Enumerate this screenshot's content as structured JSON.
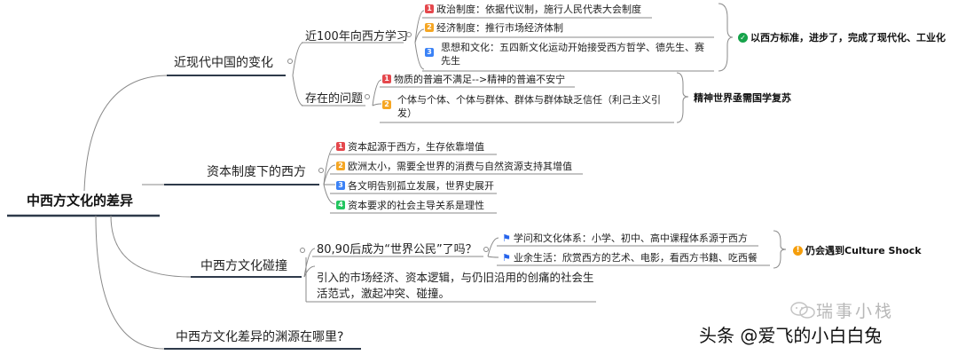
{
  "root": "中西方文化的差异",
  "branches": [
    {
      "label": "近现代中国的变化",
      "subs": [
        {
          "label": "近100年向西方学习",
          "leaves": [
            {
              "badge": "1",
              "text": "政治制度：依据代议制，施行人民代表大会制度"
            },
            {
              "badge": "2",
              "text": "经济制度：推行市场经济体制"
            },
            {
              "badge": "3",
              "text": "思想和文化：五四新文化运动开始接受西方哲学、德先生、赛先生"
            }
          ],
          "note": "以西方标准，进步了，完成了现代化、工业化"
        },
        {
          "label": "存在的问题",
          "leaves": [
            {
              "badge": "1",
              "text": "物质的普遍不满足-->精神的普遍不安宁"
            },
            {
              "badge": "2",
              "text": "个体与个体、个体与群体、群体与群体缺乏信任（利己主义引发）"
            }
          ],
          "note": "精神世界亟需国学复苏"
        }
      ]
    },
    {
      "label": "资本制度下的西方",
      "leaves": [
        {
          "badge": "1",
          "text": "资本起源于西方，生存依靠增值"
        },
        {
          "badge": "2",
          "text": "欧洲太小，需要全世界的消费与自然资源支持其增值"
        },
        {
          "badge": "3",
          "text": "各文明告别孤立发展，世界史展开"
        },
        {
          "badge": "4",
          "text": "资本要求的社会主导关系是理性"
        }
      ]
    },
    {
      "label": "中西方文化碰撞",
      "subs": [
        {
          "label": "80,90后成为“世界公民”了吗？",
          "leaves": [
            {
              "text": "学问和文化体系：小学、初中、高中课程体系源于西方"
            },
            {
              "text": "业余生活：欣赏西方的艺术、电影，看西方书籍、吃西餐"
            }
          ],
          "note": "仍会遇到Culture Shock"
        },
        {
          "label": "引入的市场经济、资本逻辑，与仍旧沿用的创痛的社会生活范式，激起冲突、碰撞。"
        }
      ]
    },
    {
      "label": "中西方文化差异的渊源在哪里?"
    }
  ],
  "watermark": {
    "account": "瑞事小栈",
    "byline": "头条 @爱飞的小白白兔"
  },
  "colors": {
    "line": "#8a8a8a",
    "branch_underline": "#2e3a4a",
    "badge_red": "#e5484d",
    "badge_orange": "#f5a623",
    "badge_blue": "#3b82f6",
    "badge_green": "#22c55e",
    "check": "#16a34a",
    "warn": "#f59e0b"
  }
}
